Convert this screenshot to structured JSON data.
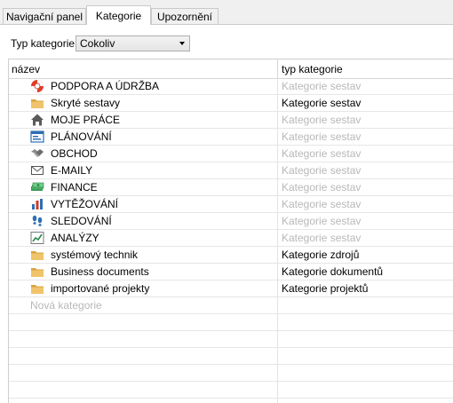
{
  "tabs": [
    {
      "label": "Navigační panel",
      "active": false
    },
    {
      "label": "Kategorie",
      "active": true
    },
    {
      "label": "Upozornění",
      "active": false
    }
  ],
  "filter": {
    "label": "Typ kategorie:",
    "selected": "Cokoliv"
  },
  "grid": {
    "columns": [
      "název",
      "typ kategorie"
    ],
    "rows": [
      {
        "name": "PODPORA A ÚDRŽBA",
        "type": "Kategorie sestav",
        "icon": "lifebuoy-icon",
        "type_muted": true
      },
      {
        "name": "Skryté sestavy",
        "type": "Kategorie sestav",
        "icon": "folder-icon",
        "type_muted": false
      },
      {
        "name": "MOJE PRÁCE",
        "type": "Kategorie sestav",
        "icon": "house-icon",
        "type_muted": true
      },
      {
        "name": "PLÁNOVÁNÍ",
        "type": "Kategorie sestav",
        "icon": "planning-board-icon",
        "type_muted": true
      },
      {
        "name": "OBCHOD",
        "type": "Kategorie sestav",
        "icon": "handshake-icon",
        "type_muted": true
      },
      {
        "name": "E-MAILY",
        "type": "Kategorie sestav",
        "icon": "envelope-icon",
        "type_muted": true
      },
      {
        "name": "FINANCE",
        "type": "Kategorie sestav",
        "icon": "money-stack-icon",
        "type_muted": true
      },
      {
        "name": "VYTĚŽOVÁNÍ",
        "type": "Kategorie sestav",
        "icon": "bar-chart-icon",
        "type_muted": true
      },
      {
        "name": "SLEDOVÁNÍ",
        "type": "Kategorie sestav",
        "icon": "footprints-icon",
        "type_muted": true
      },
      {
        "name": "ANALÝZY",
        "type": "Kategorie sestav",
        "icon": "line-chart-icon",
        "type_muted": true
      },
      {
        "name": "systémový technik",
        "type": "Kategorie zdrojů",
        "icon": "folder-icon",
        "type_muted": false
      },
      {
        "name": "Business documents",
        "type": "Kategorie dokumentů",
        "icon": "folder-icon",
        "type_muted": false
      },
      {
        "name": "importované projekty",
        "type": "Kategorie projektů",
        "icon": "folder-icon",
        "type_muted": false
      }
    ],
    "new_row_placeholder": "Nová kategorie"
  },
  "colors": {
    "muted_text": "#b8b8b8",
    "folder": "#e8b95a",
    "grid_line": "#e6e6e6"
  }
}
